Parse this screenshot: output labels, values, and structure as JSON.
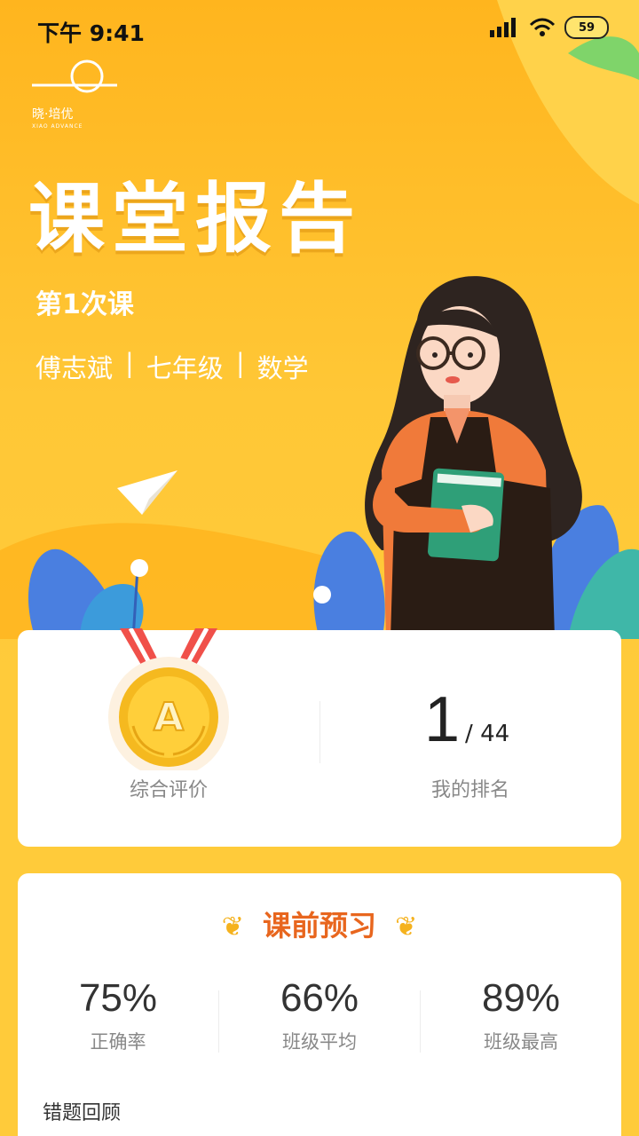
{
  "status_bar": {
    "time": "下午 9:41",
    "battery": "59"
  },
  "logo": {
    "text": "晓·培优",
    "sub": "XIAO ADVANCE"
  },
  "header": {
    "title": "课堂报告",
    "lesson": "第1次课",
    "student": "傅志斌",
    "grade": "七年级",
    "subject": "数学",
    "separator": "|"
  },
  "summary": {
    "medal_letter": "A",
    "overall_label": "综合评价",
    "rank_value": "1",
    "rank_total": "/ 44",
    "rank_label": "我的排名"
  },
  "preview": {
    "title": "课前预习",
    "stats": [
      {
        "value": "75%",
        "label": "正确率"
      },
      {
        "value": "66%",
        "label": "班级平均"
      },
      {
        "value": "89%",
        "label": "班级最高"
      }
    ],
    "review_label": "错题回顾"
  },
  "colors": {
    "accent": "#E8661E",
    "background": "#FFC736"
  }
}
